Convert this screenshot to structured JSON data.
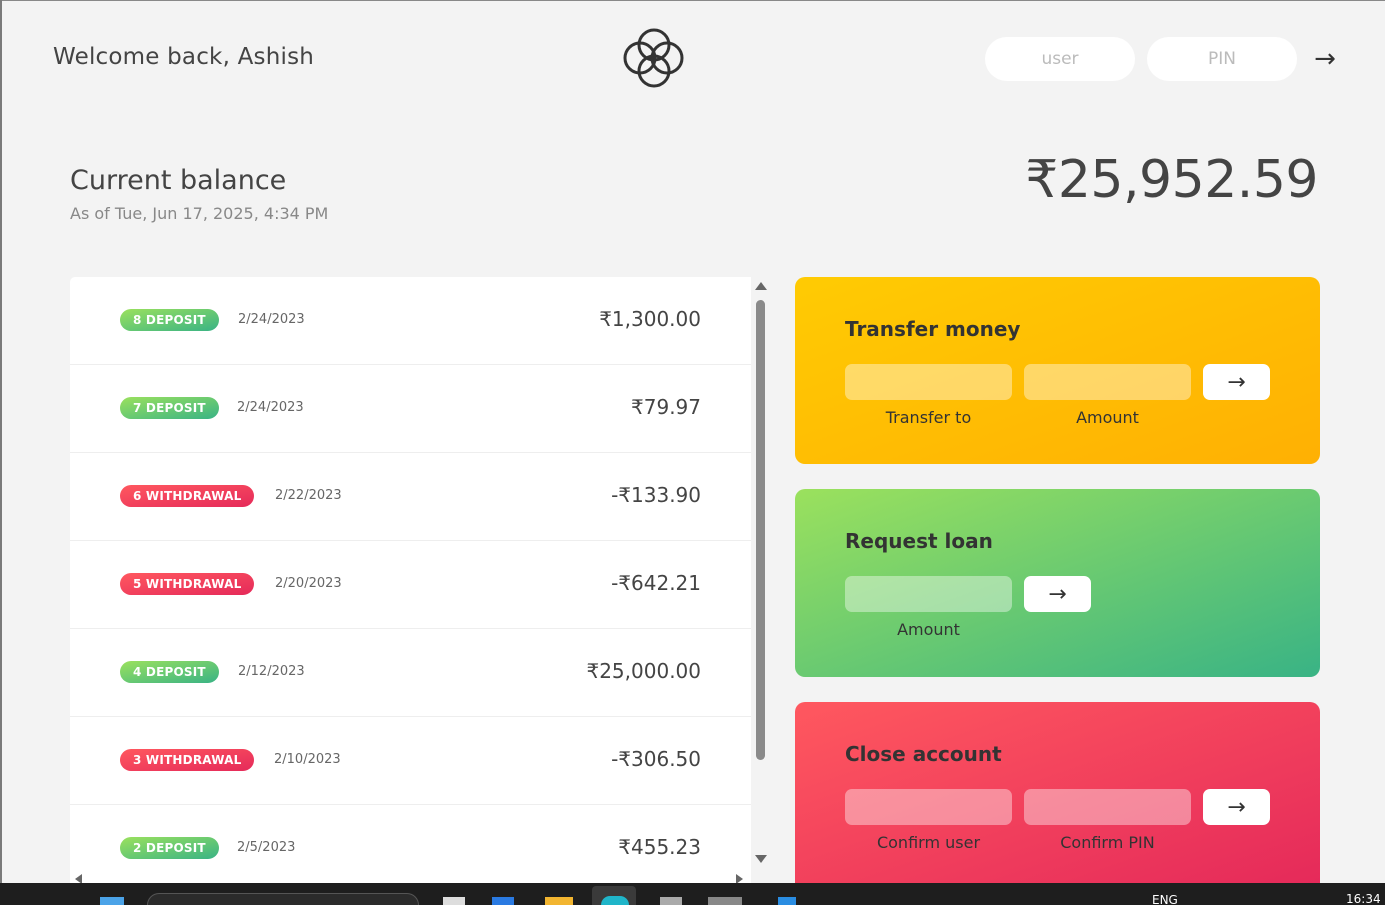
{
  "nav": {
    "welcome": "Welcome back, Ashish",
    "user_placeholder": "user",
    "pin_placeholder": "PIN",
    "login_arrow": "→"
  },
  "balance": {
    "label": "Current balance",
    "date": "As of Tue, Jun 17, 2025, 4:34 PM",
    "value": "₹25,952.59"
  },
  "movements": [
    {
      "type_label": "8 DEPOSIT",
      "kind": "deposit",
      "date": "2/24/2023",
      "value": "₹1,300.00"
    },
    {
      "type_label": "7 DEPOSIT",
      "kind": "deposit",
      "date": "2/24/2023",
      "value": "₹79.97"
    },
    {
      "type_label": "6 WITHDRAWAL",
      "kind": "withdrawal",
      "date": "2/22/2023",
      "value": "-₹133.90"
    },
    {
      "type_label": "5 WITHDRAWAL",
      "kind": "withdrawal",
      "date": "2/20/2023",
      "value": "-₹642.21"
    },
    {
      "type_label": "4 DEPOSIT",
      "kind": "deposit",
      "date": "2/12/2023",
      "value": "₹25,000.00"
    },
    {
      "type_label": "3 WITHDRAWAL",
      "kind": "withdrawal",
      "date": "2/10/2023",
      "value": "-₹306.50"
    },
    {
      "type_label": "2 DEPOSIT",
      "kind": "deposit",
      "date": "2/5/2023",
      "value": "₹455.23"
    }
  ],
  "operations": {
    "transfer": {
      "title": "Transfer money",
      "label_to": "Transfer to",
      "label_amount": "Amount",
      "button": "→"
    },
    "loan": {
      "title": "Request loan",
      "label_amount": "Amount",
      "button": "→"
    },
    "close": {
      "title": "Close account",
      "label_user": "Confirm user",
      "label_pin": "Confirm PIN",
      "button": "→"
    }
  },
  "taskbar": {
    "lang": "ENG",
    "time": "16:34"
  },
  "colors": {
    "deposit_gradient": [
      "#39b385",
      "#9be15d"
    ],
    "withdrawal_gradient": [
      "#e52a5a",
      "#ff585f"
    ],
    "transfer_gradient": [
      "#ffb003",
      "#ffcb03"
    ],
    "background": "#f3f3f3"
  }
}
